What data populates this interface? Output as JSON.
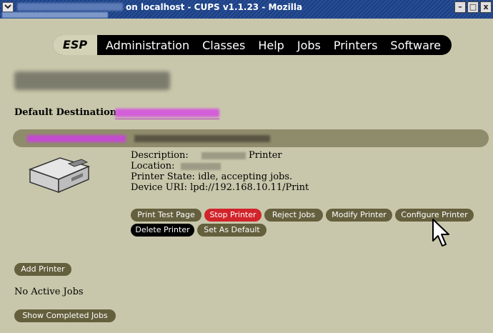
{
  "window": {
    "title": "on localhost - CUPS v1.1.23 - Mozilla",
    "minimize": "–",
    "maximize": "□",
    "close": "x"
  },
  "nav": {
    "brand": "ESP",
    "items": [
      "Administration",
      "Classes",
      "Help",
      "Jobs",
      "Printers",
      "Software"
    ]
  },
  "default_destination": {
    "label": "Default Destination:"
  },
  "printer": {
    "description_label": "Description:",
    "description_value": "Printer",
    "location_label": "Location:",
    "state": "Printer State: idle, accepting jobs.",
    "device_uri": "Device URI: lpd://192.168.10.11/Print"
  },
  "buttons": {
    "print_test_page": "Print Test Page",
    "stop_printer": "Stop Printer",
    "reject_jobs": "Reject Jobs",
    "modify_printer": "Modify Printer",
    "configure_printer": "Configure Printer",
    "delete_printer": "Delete Printer",
    "set_as_default": "Set As Default",
    "add_printer": "Add Printer",
    "show_completed_jobs": "Show Completed Jobs"
  },
  "jobs": {
    "status": "No Active Jobs"
  },
  "colors": {
    "background": "#c9c7ab",
    "button": "#645f3d",
    "button_danger": "#d1232a",
    "button_dark": "#000000",
    "link": "#c34ad0"
  }
}
